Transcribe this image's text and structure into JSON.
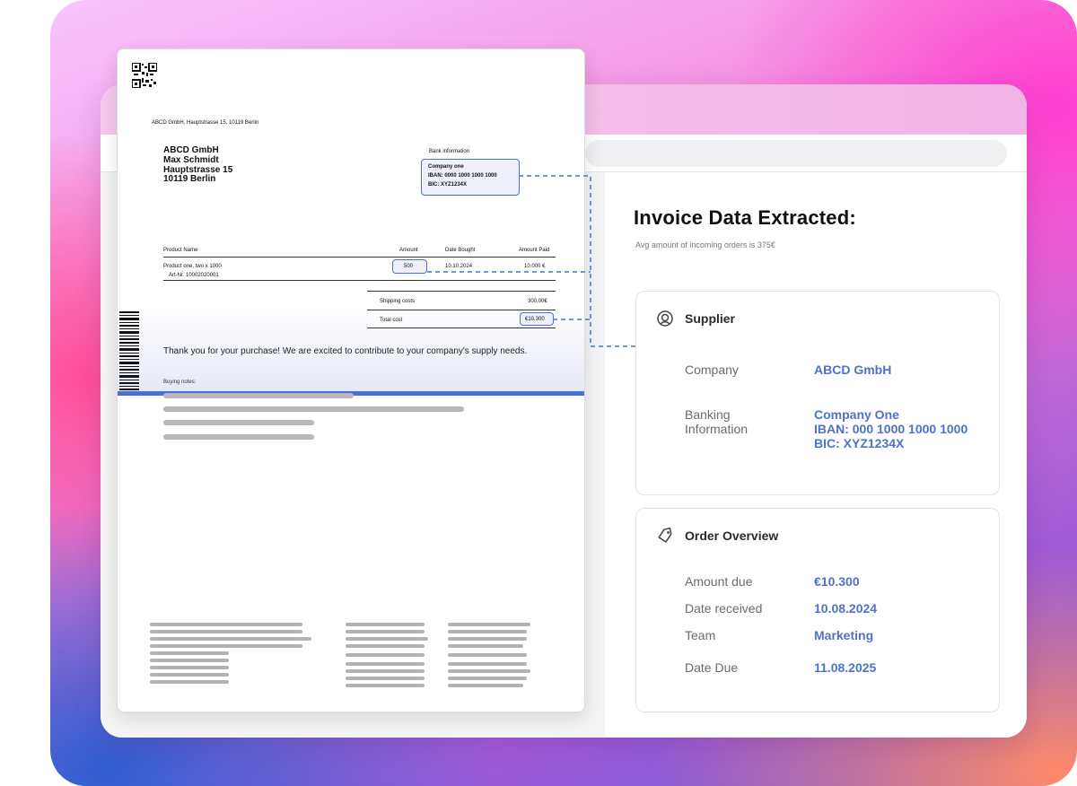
{
  "panel": {
    "title": "Invoice Data Extracted:",
    "subtitle": "Avg amount of incoming orders is 375€"
  },
  "supplier_card": {
    "icon": "supplier-icon",
    "heading": "Supplier",
    "company_label": "Company",
    "company_value": "ABCD GmbH",
    "banking_label_line1": "Banking",
    "banking_label_line2": "Information",
    "banking_value_line1": "Company One",
    "banking_value_line2": "IBAN: 000 1000 1000 1000",
    "banking_value_line3": "BIC: XYZ1234X"
  },
  "order_card": {
    "icon": "tag-icon",
    "heading": "Order Overview",
    "rows": [
      {
        "label": "Amount due",
        "value": "€10.300"
      },
      {
        "label": "Date received",
        "value": "10.08.2024"
      },
      {
        "label": "Team",
        "value": "Marketing"
      },
      {
        "label": "Date Due",
        "value": "11.08.2025"
      }
    ]
  },
  "invoice": {
    "sender_line": "ABCD GmbH, Hauptstrasse 15, 10119 Berlin",
    "recipient": {
      "line1": "ABCD GmbH",
      "line2": "Max Schmidt",
      "line3": "Hauptstrasse 15",
      "line4": "10119 Berlin"
    },
    "bank": {
      "heading": "Bank information",
      "line1": "Company one",
      "line2": "IBAN: 0000 1000 1000 1000",
      "line3": "BIC: XYZ1234X"
    },
    "table": {
      "headers": [
        "Product Name",
        "Amount",
        "Date Bought",
        "Amount Paid"
      ],
      "row": {
        "product": "Product one, two x 1000",
        "article": "Art-Nr. 10002020001",
        "amount": "500",
        "date": "10.10.2024",
        "paid": "10.000 €"
      },
      "shipping_label": "Shipping costs",
      "shipping_value": "300,00€",
      "total_label": "Total cost",
      "total_value": "€10.300"
    },
    "thanks": "Thank you for your purchase! We are excited to contribute to your company's supply needs.",
    "notes_label": "Buying notes:"
  },
  "colors": {
    "accent": "#4b6fd4",
    "value_text": "#4d73c9"
  }
}
